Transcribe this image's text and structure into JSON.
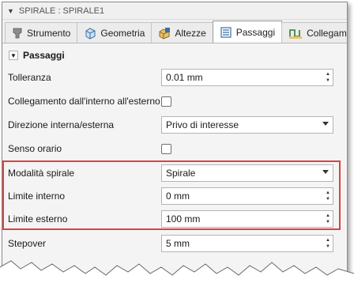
{
  "window": {
    "title": "SPIRALE : SPIRALE1"
  },
  "tabs": [
    {
      "label": "Strumento",
      "icon": "tool-icon"
    },
    {
      "label": "Geometria",
      "icon": "geometry-icon"
    },
    {
      "label": "Altezze",
      "icon": "heights-icon"
    },
    {
      "label": "Passaggi",
      "icon": "passes-icon",
      "active": true
    },
    {
      "label": "Collegamento",
      "icon": "linking-icon"
    }
  ],
  "section": {
    "title": "Passaggi"
  },
  "fields": {
    "tolleranza": {
      "label": "Tolleranza",
      "value": "0.01 mm"
    },
    "collegamento": {
      "label": "Collegamento dall'interno all'esterno",
      "checked": false
    },
    "direzione": {
      "label": "Direzione interna/esterna",
      "value": "Privo di interesse"
    },
    "senso": {
      "label": "Senso orario",
      "checked": false
    },
    "modalita": {
      "label": "Modalità spirale",
      "value": "Spirale"
    },
    "limite_interno": {
      "label": "Limite interno",
      "value": "0 mm"
    },
    "limite_esterno": {
      "label": "Limite esterno",
      "value": "100 mm"
    },
    "stepover": {
      "label": "Stepover",
      "value": "5 mm"
    }
  },
  "colors": {
    "highlight": "#d9443f"
  }
}
